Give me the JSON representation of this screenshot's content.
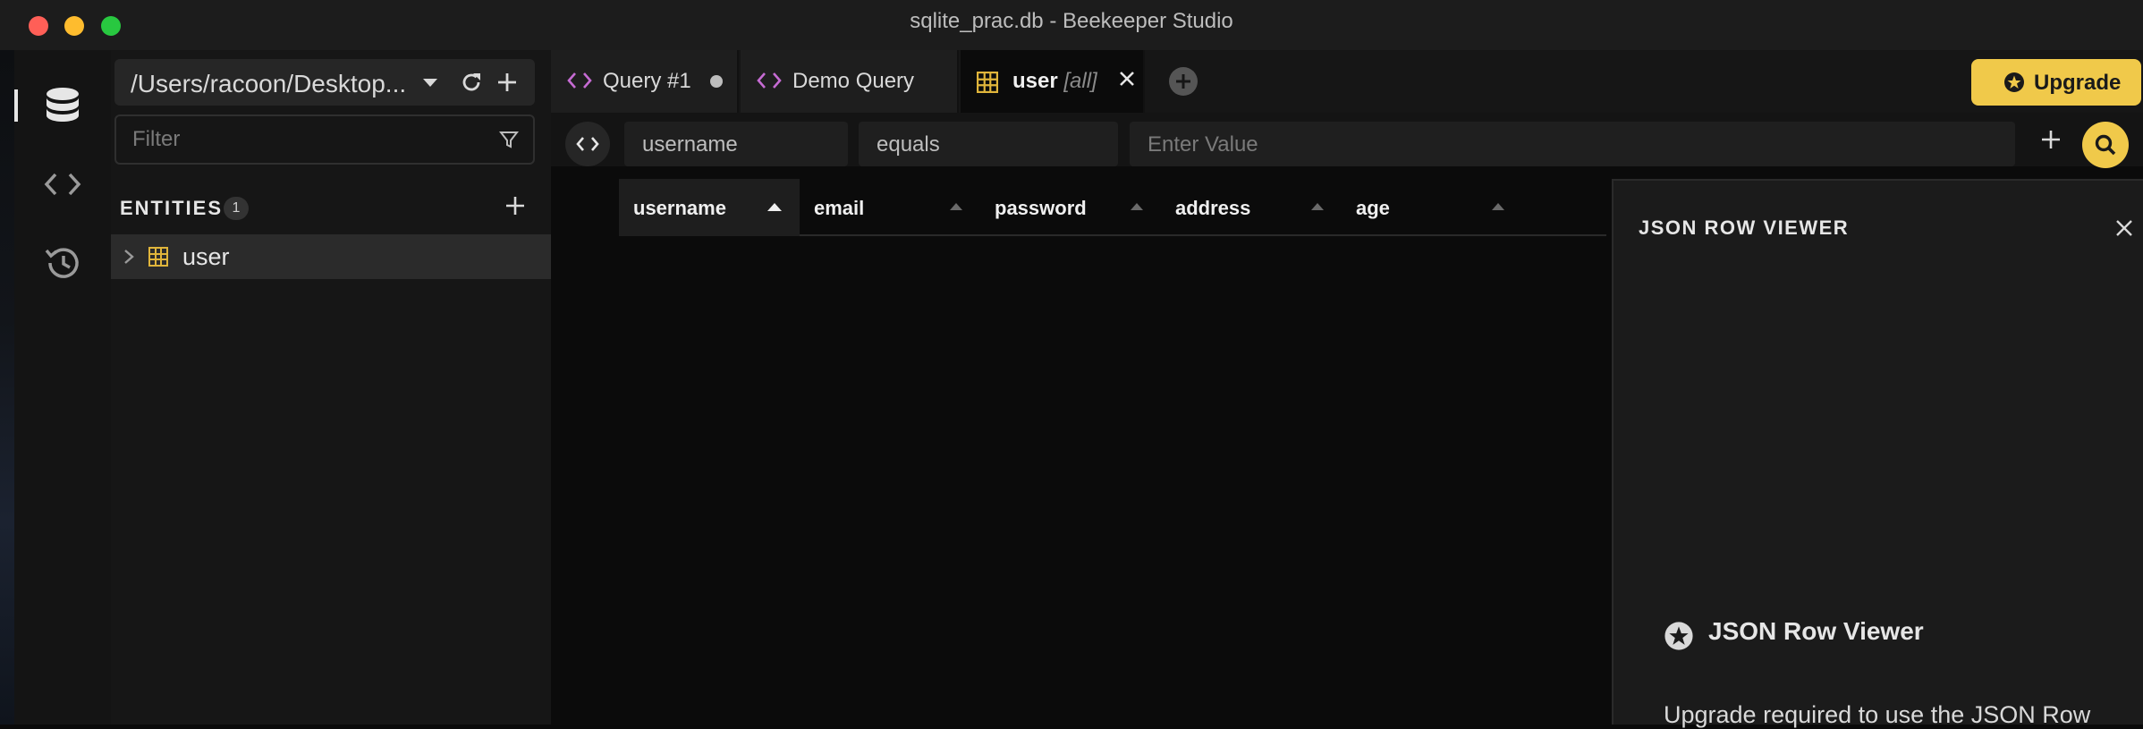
{
  "window": {
    "title": "sqlite_prac.db - Beekeeper Studio"
  },
  "activity_bar": {
    "items": [
      "database-icon",
      "code-icon",
      "history-icon"
    ]
  },
  "sidebar": {
    "connection_path": "/Users/racoon/Desktop...",
    "filter_placeholder": "Filter",
    "entities_label": "ENTITIES",
    "entities_count": "1",
    "entities": [
      {
        "label": "user"
      }
    ]
  },
  "tabs": [
    {
      "label": "Query #1",
      "unsaved": true
    },
    {
      "label": "Demo Query"
    },
    {
      "label": "user",
      "qualifier": "[all]",
      "active": true
    }
  ],
  "upgrade": {
    "label": "Upgrade",
    "color": "#f0c94a"
  },
  "filter": {
    "field": "username",
    "operator": "equals",
    "value_placeholder": "Enter Value"
  },
  "grid": {
    "columns": [
      {
        "name": "username",
        "sorted": "asc"
      },
      {
        "name": "email"
      },
      {
        "name": "password"
      },
      {
        "name": "address"
      },
      {
        "name": "age"
      }
    ]
  },
  "json_panel": {
    "title": "JSON ROW VIEWER",
    "promo_title": "JSON Row Viewer",
    "promo_text": "Upgrade required to use the JSON Row"
  }
}
